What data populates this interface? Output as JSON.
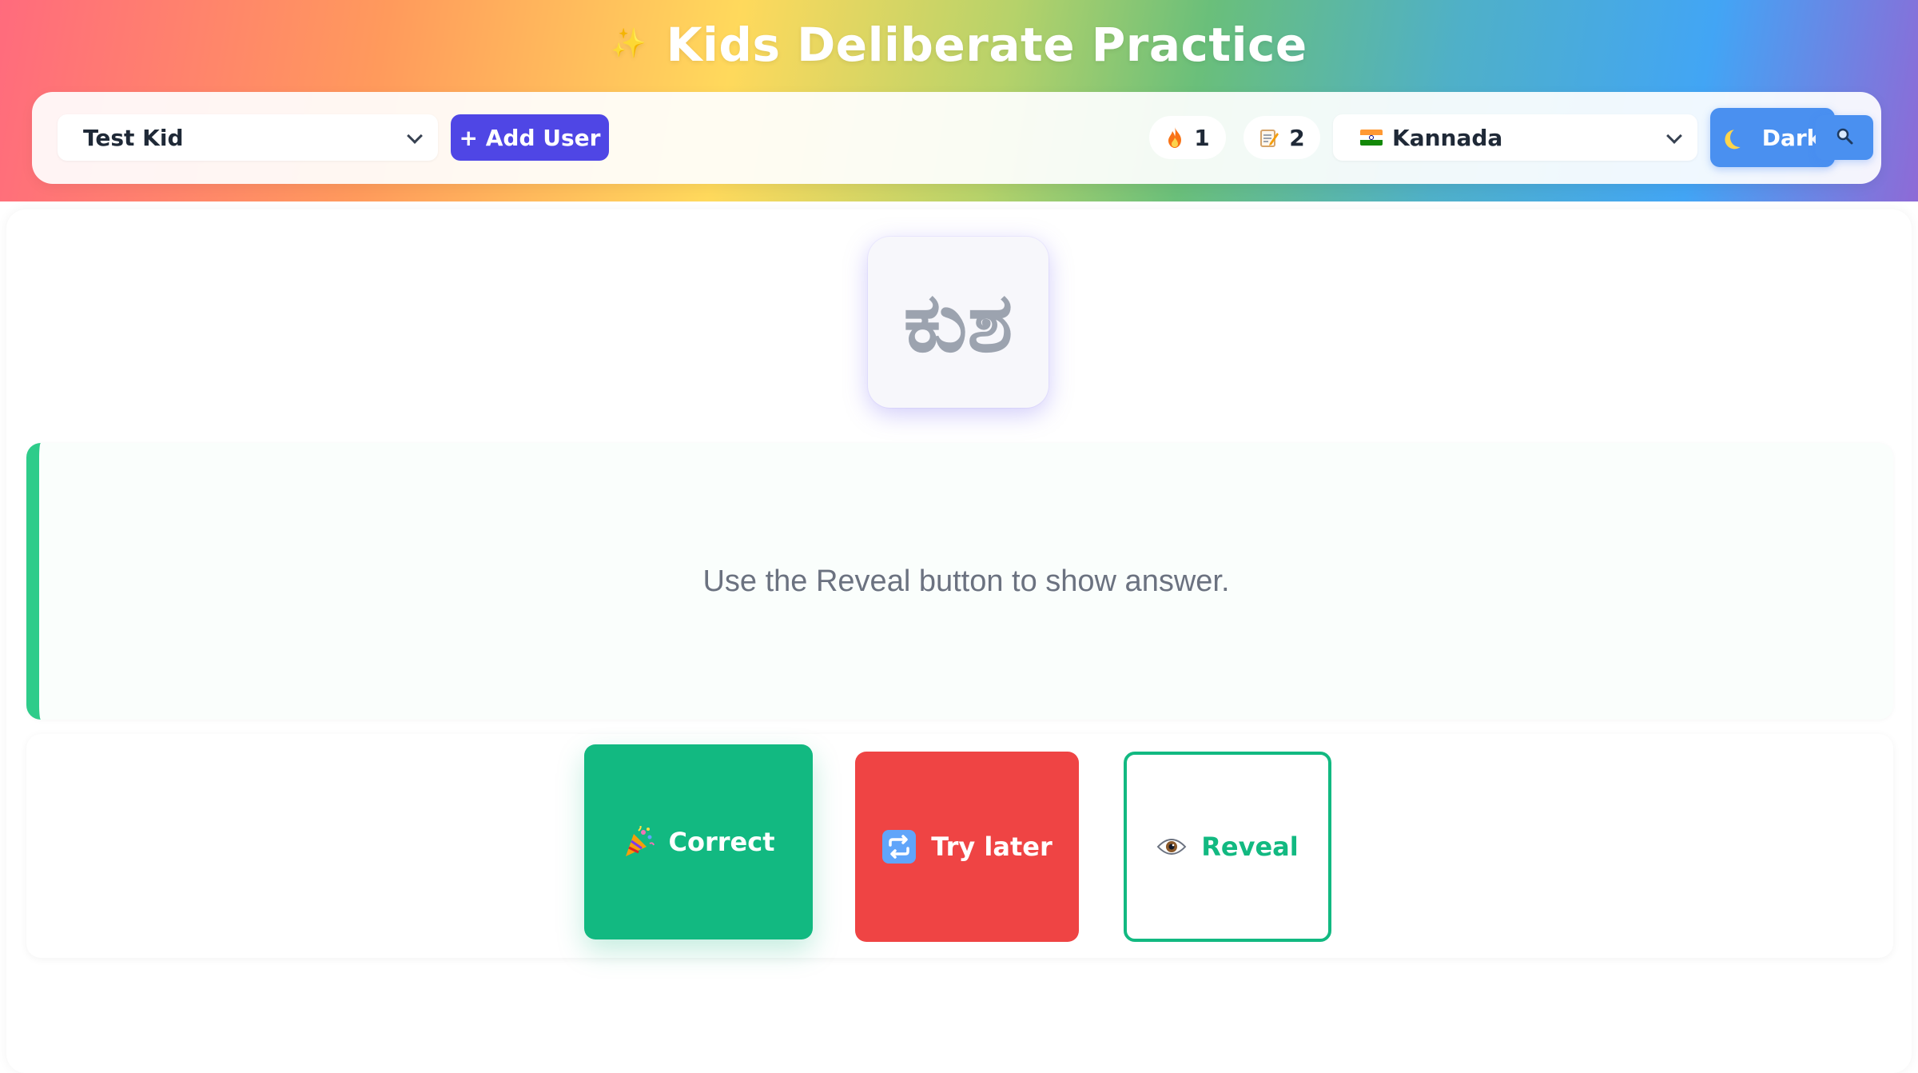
{
  "app": {
    "title": "Kids Deliberate Practice",
    "accent_color": "#4f46e5",
    "sparkle_icon": "sparkle-icon"
  },
  "toolbar": {
    "user_select": {
      "value": "Test Kid"
    },
    "add_user_label": "+ Add User",
    "streak": {
      "icon": "fire-icon",
      "count": "1"
    },
    "notes": {
      "icon": "memo-icon",
      "count": "2"
    },
    "language_select": {
      "icon": "india-flag-icon",
      "value": "Kannada"
    },
    "dark_label": "Dark",
    "dark_icon": "moon-icon",
    "search_icon": "search-icon"
  },
  "card": {
    "prompt_glyph": "ಕುಶ",
    "answer_hint": "Use the Reveal button to show answer."
  },
  "actions": {
    "correct": {
      "label": "Correct",
      "icon": "party-popper-icon",
      "color": "#12b981"
    },
    "try_later": {
      "label": "Try later",
      "icon": "repeat-icon",
      "color": "#ef4444"
    },
    "reveal": {
      "label": "Reveal",
      "icon": "eye-icon",
      "color": "#12b981"
    }
  }
}
